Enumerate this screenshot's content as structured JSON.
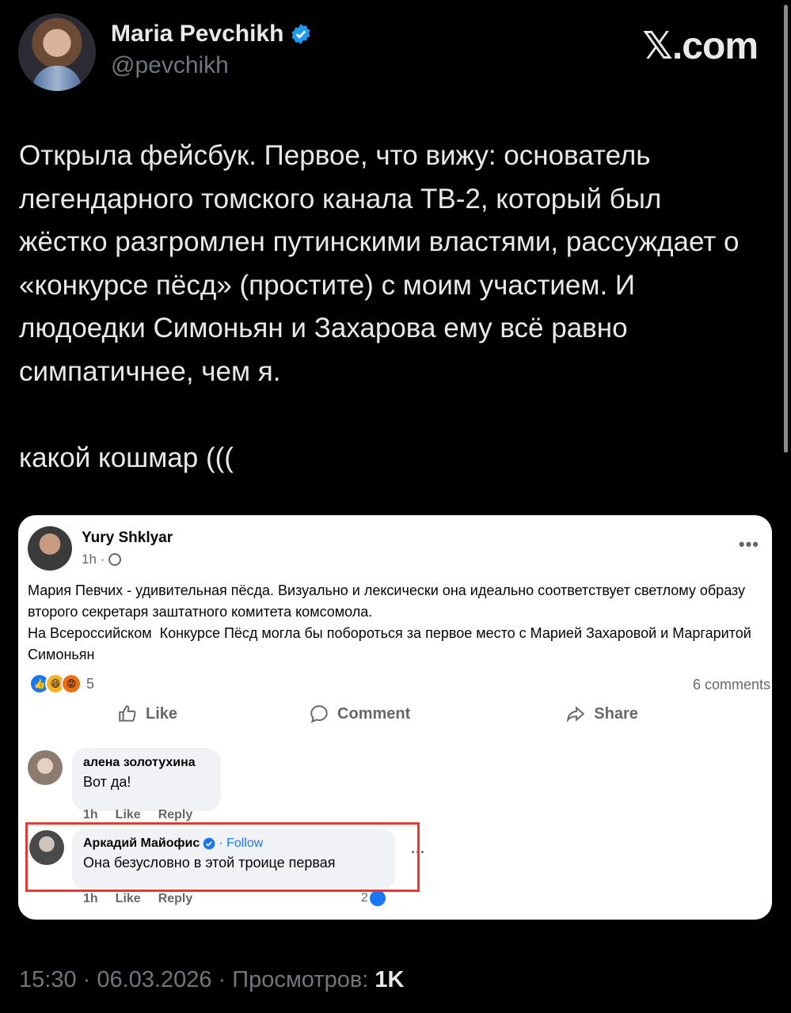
{
  "tweet": {
    "author_name": "Maria Pevchikh",
    "handle": "@pevchikh",
    "brand": "𝕏.com",
    "text": "Открыла фейсбук. Первое, что вижу: основатель легендарного томского канала ТВ-2, который был жёстко разгромлен путинскими властями, рассуждает о «конкурсе пёсд» (простите) с моим участием. И людоедки Симоньян и Захарова ему всё равно симпатичнее, чем я.\n\nкакой кошмар (((",
    "timestamp": "15:30 · 06.03.2026 · Просмотров: ",
    "views": "1K"
  },
  "fb_post": {
    "author": "Yury Shklyar",
    "time": "1h ·",
    "more": "•••",
    "text": "Мария Певчих - удивительная пёсда. Визуально и лексически она идеально соответствует светлому образу второго секретаря заштатного комитета комсомола.\nНа Всероссийском  Конкурсе Пёсд могла бы побороться за первое место с Марией Захаровой и Маргаритой Симоньян",
    "reaction_count": "5",
    "comments_count": "6 comments",
    "actions": {
      "like": "Like",
      "comment": "Comment",
      "share": "Share"
    },
    "comments": [
      {
        "name": "алена золотухина",
        "text": "Вот да!",
        "time": "1h",
        "like": "Like",
        "reply": "Reply"
      },
      {
        "name": "Аркадий Майофис",
        "follow": "· Follow",
        "text": "Она безусловно в этой троице первая",
        "time": "1h",
        "like": "Like",
        "reply": "Reply",
        "reactions": "2",
        "more": "···"
      }
    ]
  },
  "colors": {
    "background": "#000000",
    "text": "#e7e9ea",
    "muted": "#71767b",
    "verified": "#1d9bf0",
    "fb_blue": "#1877f2",
    "highlight": "#e53935"
  }
}
